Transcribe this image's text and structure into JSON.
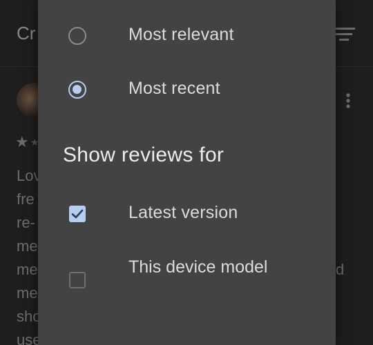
{
  "background": {
    "title_fragment": "Cr",
    "rating_star": "★",
    "review_lines": [
      "Lov",
      "fre",
      "re-",
      "me",
      "me",
      "me",
      "sho",
      "use"
    ],
    "right_fragment": "d"
  },
  "sort_options": [
    {
      "label": "Most relevant",
      "selected": false
    },
    {
      "label": "Most recent",
      "selected": true
    }
  ],
  "filter_section": {
    "heading": "Show reviews for",
    "items": [
      {
        "label": "Latest version",
        "checked": true
      },
      {
        "label": "This device model",
        "checked": false
      }
    ]
  },
  "colors": {
    "sheet_bg": "#434343",
    "accent": "#b8cdf2",
    "text": "#dcdcdc",
    "scrim_bg": "#1e1e1e"
  },
  "icons": {
    "sort": "sort-lines-icon",
    "more": "more-vertical-icon",
    "check": "check-icon"
  }
}
